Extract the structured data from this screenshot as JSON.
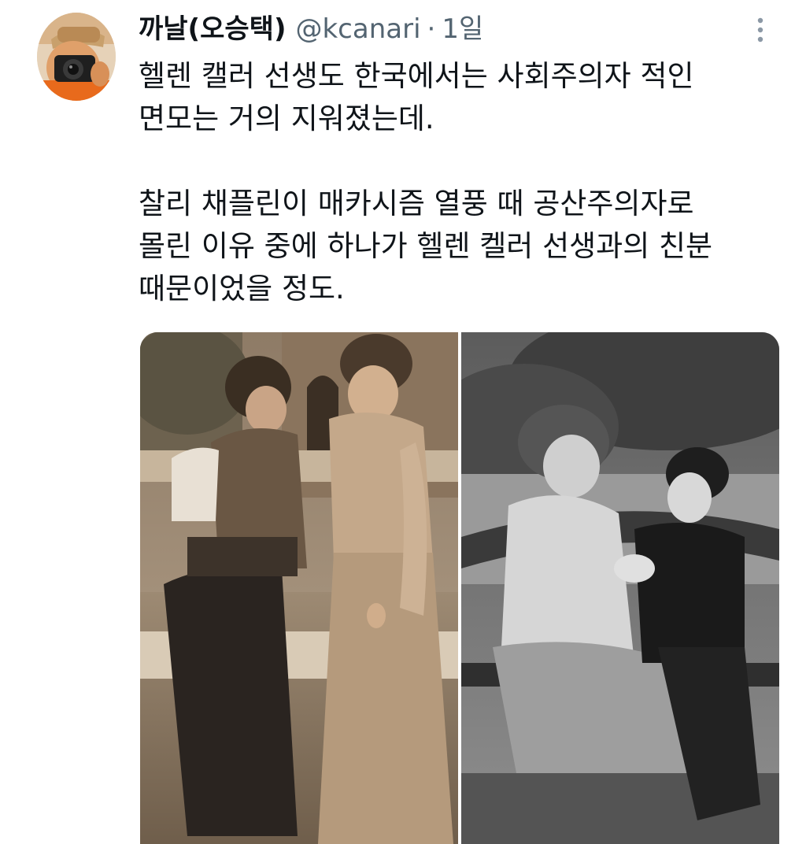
{
  "tweet": {
    "author": {
      "display_name": "까날(오승택)",
      "handle": "@kcanari",
      "avatar_icon": "camera-selfie-avatar"
    },
    "separator": "·",
    "timestamp": "1일",
    "more_icon": "more-vertical-icon",
    "text": {
      "paragraph_1": "헬렌 캘러 선생도 한국에서는 사회주의자 적인\n면모는 거의 지워졌는데.",
      "paragraph_2": "찰리 채플린이 매카시즘 열풍 때 공산주의자로\n몰린 이유 중에 하나가 헬렌 켈러 선생과의 친분\n때문이었을 정도."
    },
    "media": {
      "photo_count": 2,
      "colors": {
        "sepia": "#8a7560",
        "bw": "#6e6e6e"
      }
    }
  }
}
